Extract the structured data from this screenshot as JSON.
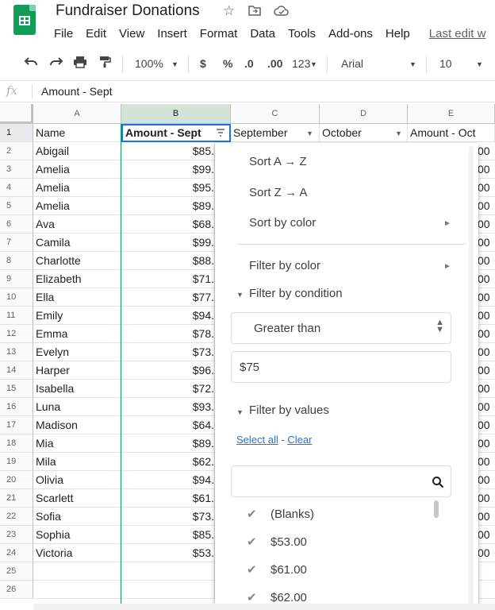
{
  "title": "Fundraiser Donations",
  "title_icons": [
    "star-icon",
    "move-to-folder-icon",
    "cloud-status-icon"
  ],
  "menu": [
    "File",
    "Edit",
    "View",
    "Insert",
    "Format",
    "Data",
    "Tools",
    "Add-ons",
    "Help"
  ],
  "last_edit": "Last edit w",
  "toolbar": {
    "zoom": "100%",
    "currency": "$",
    "percent": "%",
    "dec_decrease": ".0",
    "dec_increase": ".00",
    "more_formats": "123",
    "font": "Arial",
    "font_size": "10"
  },
  "formula_bar": {
    "fx": "fx",
    "value": "Amount - Sept"
  },
  "columns": [
    "A",
    "B",
    "C",
    "D",
    "E"
  ],
  "header_row": {
    "name": "Name",
    "amount_sept": "Amount - Sept",
    "september": "September",
    "october": "October",
    "amount_oct": "Amount - Oct"
  },
  "rows": [
    {
      "n": "2",
      "name": "Abigail",
      "amt": "$85.",
      "e": "00"
    },
    {
      "n": "3",
      "name": "Amelia",
      "amt": "$99.",
      "e": "00"
    },
    {
      "n": "4",
      "name": "Amelia",
      "amt": "$95.",
      "e": "00"
    },
    {
      "n": "5",
      "name": "Amelia",
      "amt": "$89.",
      "e": "00"
    },
    {
      "n": "6",
      "name": "Ava",
      "amt": "$68.",
      "e": "00"
    },
    {
      "n": "7",
      "name": "Camila",
      "amt": "$99.",
      "e": "00"
    },
    {
      "n": "8",
      "name": "Charlotte",
      "amt": "$88.",
      "e": "00"
    },
    {
      "n": "9",
      "name": "Elizabeth",
      "amt": "$71.",
      "e": "00"
    },
    {
      "n": "10",
      "name": "Ella",
      "amt": "$77.",
      "e": "00"
    },
    {
      "n": "11",
      "name": "Emily",
      "amt": "$94.",
      "e": "00"
    },
    {
      "n": "12",
      "name": "Emma",
      "amt": "$78.",
      "e": "00"
    },
    {
      "n": "13",
      "name": "Evelyn",
      "amt": "$73.",
      "e": "00"
    },
    {
      "n": "14",
      "name": "Harper",
      "amt": "$96.",
      "e": "00"
    },
    {
      "n": "15",
      "name": "Isabella",
      "amt": "$72.",
      "e": "00"
    },
    {
      "n": "16",
      "name": "Luna",
      "amt": "$93.",
      "e": "00"
    },
    {
      "n": "17",
      "name": "Madison",
      "amt": "$64.",
      "e": "00"
    },
    {
      "n": "18",
      "name": "Mia",
      "amt": "$89.",
      "e": "00"
    },
    {
      "n": "19",
      "name": "Mila",
      "amt": "$62.",
      "e": "00"
    },
    {
      "n": "20",
      "name": "Olivia",
      "amt": "$94.",
      "e": "00"
    },
    {
      "n": "21",
      "name": "Scarlett",
      "amt": "$61.",
      "e": "00"
    },
    {
      "n": "22",
      "name": "Sofia",
      "amt": "$73.",
      "e": "00"
    },
    {
      "n": "23",
      "name": "Sophia",
      "amt": "$85.",
      "e": "00"
    },
    {
      "n": "24",
      "name": "Victoria",
      "amt": "$53.",
      "e": "00"
    },
    {
      "n": "25",
      "name": "",
      "amt": "",
      "e": ""
    },
    {
      "n": "26",
      "name": "",
      "amt": "",
      "e": ""
    }
  ],
  "filter_menu": {
    "sort_az": "Sort A → Z",
    "sort_za": "Sort Z → A",
    "sort_by_color": "Sort by color",
    "filter_by_color": "Filter by color",
    "filter_by_condition": "Filter by condition",
    "condition": "Greater than",
    "condition_value": "$75",
    "filter_by_values": "Filter by values",
    "select_all": "Select all",
    "link_sep": " - ",
    "clear": "Clear",
    "search_placeholder": "",
    "values": [
      {
        "label": "(Blanks)",
        "checked": true
      },
      {
        "label": "$53.00",
        "checked": true
      },
      {
        "label": "$61.00",
        "checked": true
      },
      {
        "label": "$62.00",
        "checked": true
      }
    ]
  }
}
